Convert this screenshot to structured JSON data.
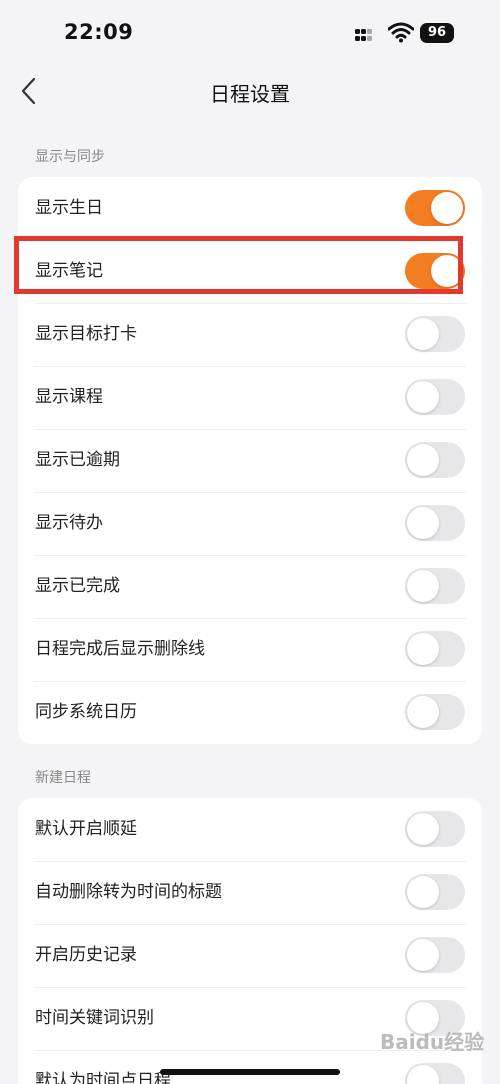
{
  "status_bar": {
    "time": "22:09",
    "battery": "96"
  },
  "nav": {
    "title": "日程设置"
  },
  "sections": [
    {
      "label": "显示与同步",
      "items": [
        {
          "label": "显示生日",
          "on": true
        },
        {
          "label": "显示笔记",
          "on": true
        },
        {
          "label": "显示目标打卡",
          "on": false
        },
        {
          "label": "显示课程",
          "on": false
        },
        {
          "label": "显示已逾期",
          "on": false
        },
        {
          "label": "显示待办",
          "on": false
        },
        {
          "label": "显示已完成",
          "on": false
        },
        {
          "label": "日程完成后显示删除线",
          "on": false
        },
        {
          "label": "同步系统日历",
          "on": false
        }
      ]
    },
    {
      "label": "新建日程",
      "items": [
        {
          "label": "默认开启顺延",
          "on": false
        },
        {
          "label": "自动删除转为时间的标题",
          "on": false
        },
        {
          "label": "开启历史记录",
          "on": false
        },
        {
          "label": "时间关键词识别",
          "on": false
        },
        {
          "label": "默认为时间点日程",
          "on": false
        }
      ]
    }
  ],
  "watermark": "Baidu经验",
  "colors": {
    "accent": "#f47c21",
    "highlight": "#e2392e"
  }
}
